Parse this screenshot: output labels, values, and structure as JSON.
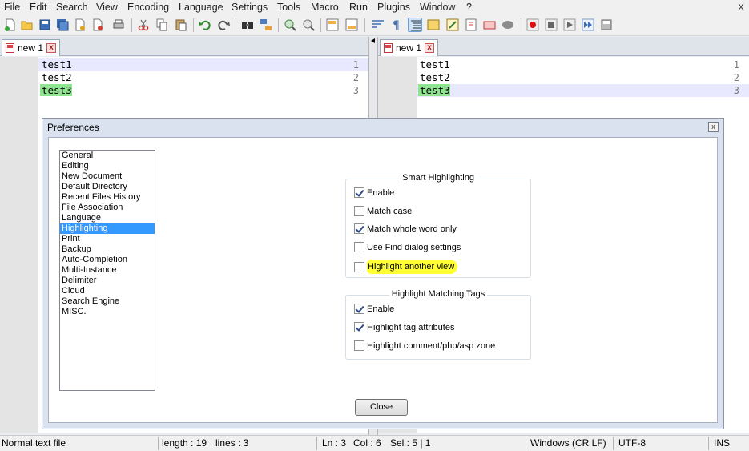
{
  "menu": [
    "File",
    "Edit",
    "Search",
    "View",
    "Encoding",
    "Language",
    "Settings",
    "Tools",
    "Macro",
    "Run",
    "Plugins",
    "Window",
    "?"
  ],
  "window_close": "X",
  "toolbar_icons": [
    "new-file-icon",
    "open-file-icon",
    "save-icon",
    "save-all-icon",
    "close-icon",
    "close-all-icon",
    "print-icon",
    "cut-icon",
    "copy-icon",
    "paste-icon",
    "undo-icon",
    "redo-icon",
    "find-icon",
    "replace-icon",
    "zoom-in-icon",
    "zoom-out-icon",
    "sync-vertical-icon",
    "sync-horizontal-icon",
    "word-wrap-icon",
    "show-all-chars-icon",
    "indent-guide-icon",
    "doc-map-icon",
    "function-list-icon",
    "folder-workspace-icon",
    "monitoring-icon",
    "record-macro-icon",
    "stop-macro-icon",
    "play-macro-icon",
    "run-macro-multiple-icon",
    "save-macro-icon"
  ],
  "left_tab": {
    "label": "new 1",
    "close": "x"
  },
  "right_tab": {
    "label": "new 1",
    "close": "x"
  },
  "lines": [
    {
      "num": "1",
      "text": "test1"
    },
    {
      "num": "2",
      "text": "test2"
    },
    {
      "num": "3",
      "text": "test3"
    }
  ],
  "dialog": {
    "title": "Preferences",
    "close_glyph": "x",
    "categories": [
      "General",
      "Editing",
      "New Document",
      "Default Directory",
      "Recent Files History",
      "File Association",
      "Language",
      "Highlighting",
      "Print",
      "Backup",
      "Auto-Completion",
      "Multi-Instance",
      "Delimiter",
      "Cloud",
      "Search Engine",
      "MISC."
    ],
    "selected_category": "Highlighting",
    "smart": {
      "label": "Smart Highlighting",
      "options": [
        {
          "label": "Enable",
          "checked": true
        },
        {
          "label": "Match case",
          "checked": false
        },
        {
          "label": "Match whole word only",
          "checked": true
        },
        {
          "label": "Use Find dialog settings",
          "checked": false
        },
        {
          "label": "Highlight another view",
          "checked": false
        }
      ]
    },
    "tags": {
      "label": "Highlight Matching Tags",
      "options": [
        {
          "label": "Enable",
          "checked": true
        },
        {
          "label": "Highlight tag attributes",
          "checked": true
        },
        {
          "label": "Highlight comment/php/asp zone",
          "checked": false
        }
      ]
    },
    "close_button": "Close"
  },
  "status": {
    "filetype": "Normal text file",
    "length": "length : 19",
    "lines": "lines : 3",
    "ln": "Ln : 3",
    "col": "Col : 6",
    "sel": "Sel : 5 | 1",
    "eol": "Windows (CR LF)",
    "encoding": "UTF-8",
    "mode": "INS"
  },
  "colors": {
    "smart_highlight": "#8fe58f",
    "current_line": "#e8e8ff",
    "selected_category": "#3399ff",
    "marker_highlight": "#ffff33"
  }
}
